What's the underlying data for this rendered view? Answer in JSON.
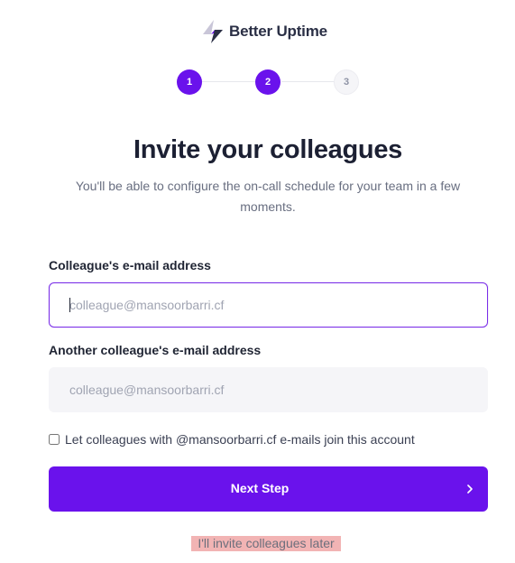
{
  "brand": {
    "name": "Better Uptime",
    "logo_icon": "lightning-bolt-icon",
    "accent_color": "#6a12ec"
  },
  "steps": [
    {
      "label": "1",
      "state": "complete"
    },
    {
      "label": "2",
      "state": "current"
    },
    {
      "label": "3",
      "state": "upcoming"
    }
  ],
  "header": {
    "title": "Invite your colleagues",
    "subtitle": "You'll be able to configure the on-call schedule for your team in a few moments."
  },
  "form": {
    "email_1": {
      "label": "Colleague's e-mail address",
      "placeholder": "colleague@mansoorbarri.cf",
      "value": ""
    },
    "email_2": {
      "label": "Another colleague's e-mail address",
      "placeholder": "colleague@mansoorbarri.cf",
      "value": ""
    },
    "domain_join": {
      "label": "Let colleagues with @mansoorbarri.cf e-mails join this account",
      "checked": false
    },
    "submit_label": "Next Step",
    "submit_icon": "chevron-right-icon",
    "skip_label": "I'll invite colleagues later"
  }
}
